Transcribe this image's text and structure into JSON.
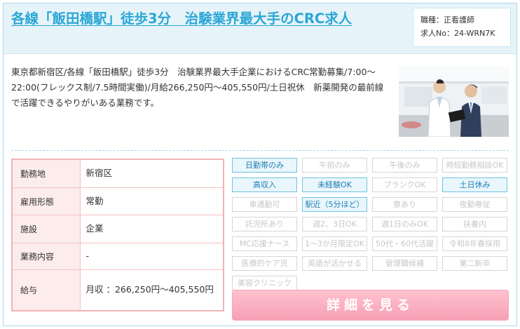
{
  "job": {
    "title": "各線「飯田橋駅」徒歩3分　治験業界最大手のCRC求人",
    "occupation_label": "職種：正看護師",
    "job_number_label": "求人No：24-WRN7K",
    "description": "東京都新宿区/各線「飯田橋駅」徒歩3分　治験業界最大手企業におけるCRC常勤募集/7:00〜22:00(フレックス制/7.5時間実働)/月給266,250円〜405,550円/土日祝休　新薬開発の最前線で活躍できるやりがいある業務です。",
    "photo_icon": "office-meeting-photo"
  },
  "details": [
    {
      "label": "勤務地",
      "value": "新宿区"
    },
    {
      "label": "雇用形態",
      "value": "常勤"
    },
    {
      "label": "施設",
      "value": "企業"
    },
    {
      "label": "業務内容",
      "value": "-"
    },
    {
      "label": "給与",
      "value": "月収 ：266,250円〜405,550円"
    }
  ],
  "tags": [
    {
      "label": "日勤帯のみ",
      "active": true
    },
    {
      "label": "午前のみ",
      "active": false
    },
    {
      "label": "午後のみ",
      "active": false
    },
    {
      "label": "時短勤務相談OK",
      "active": false
    },
    {
      "label": "高収入",
      "active": true
    },
    {
      "label": "未経験OK",
      "active": true
    },
    {
      "label": "ブランクOK",
      "active": false
    },
    {
      "label": "土日休み",
      "active": true
    },
    {
      "label": "車通勤可",
      "active": false
    },
    {
      "label": "駅近（5分ほど）",
      "active": true
    },
    {
      "label": "寮あり",
      "active": false
    },
    {
      "label": "夜勤専従",
      "active": false
    },
    {
      "label": "託児所あり",
      "active": false
    },
    {
      "label": "週2、3日OK",
      "active": false
    },
    {
      "label": "週1日のみOK",
      "active": false
    },
    {
      "label": "扶養内",
      "active": false
    },
    {
      "label": "MC応援ナース",
      "active": false
    },
    {
      "label": "1〜3か月限定OK",
      "active": false
    },
    {
      "label": "50代・60代活躍",
      "active": false
    },
    {
      "label": "令和8年春採用",
      "active": false
    },
    {
      "label": "医療的ケア児",
      "active": false
    },
    {
      "label": "英語が活かせる",
      "active": false
    },
    {
      "label": "管理職候補",
      "active": false
    },
    {
      "label": "第二新卒",
      "active": false
    },
    {
      "label": "美容クリニック",
      "active": false
    }
  ],
  "actions": {
    "detail_button": "詳細を見る"
  },
  "colors": {
    "title": "#2aa6d6",
    "header_bg": "#e6f4fa",
    "table_border": "#f3b3b3",
    "tag_active_border": "#6fc2e2",
    "button": "#f6a0b4"
  }
}
